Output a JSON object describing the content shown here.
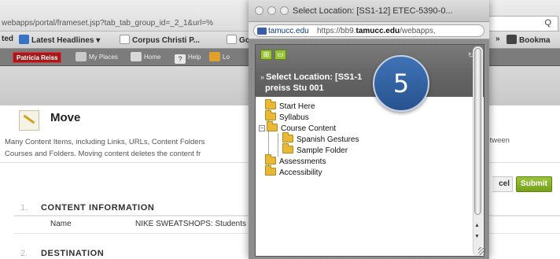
{
  "browser": {
    "url_text": "webapps/portal/frameset.jsp?tab_tab_group_id=_2_1&url=%",
    "search_glyph": "Q",
    "bookmarks": [
      {
        "label": "ted",
        "icon": "none"
      },
      {
        "label": "Latest Headlines",
        "icon": "rss-folder-icon"
      },
      {
        "label": "Corpus Christi P...",
        "icon": "page-icon"
      },
      {
        "label": "Go",
        "icon": "page-icon"
      }
    ],
    "bookmarks_overflow": "»",
    "bookmarks_menu": "Bookma"
  },
  "blackboard_bar": {
    "user": "Patricia Reiss",
    "my_places": "My Places",
    "home": "Home",
    "help": "Help",
    "logout": "Lo"
  },
  "page": {
    "title": "Move",
    "instructions_line1": "Many Content Items, including Links, URLs, Content Folders",
    "instructions_line2": "Courses and Folders. Moving content deletes the content fr",
    "instructions_right": "between",
    "cancel_label": "cel",
    "submit_label": "Submit",
    "section1_num": "1.",
    "section1_title": "CONTENT INFORMATION",
    "name_label": "Name",
    "name_value": "NIKE SWEATSHOPS: Students",
    "section2_num": "2.",
    "section2_title": "DESTINATION"
  },
  "popup": {
    "window_title": "Select Location: [SS1-12] ETEC-5390-0...",
    "address_domain": "tamucc.edu",
    "address_url_prefix": "https://bb9.",
    "address_url_bold": "tamucc.edu",
    "address_url_suffix": "/webapps,",
    "toolbar_refresh": "↻",
    "header_line1": "Select Location: [SS1-1",
    "header_line1_tail": "001",
    "header_line2": "preiss Stu 001",
    "tree": [
      {
        "label": "Start Here"
      },
      {
        "label": "Syllabus"
      },
      {
        "label": "Course Content"
      },
      {
        "label": "Spanish Gestures"
      },
      {
        "label": "Sample Folder"
      },
      {
        "label": "Assessments"
      },
      {
        "label": "Accessibility"
      }
    ]
  },
  "step_badge": "5",
  "colors": {
    "submit_green": "#8ab52a",
    "badge_blue": "#2f5fa0",
    "folder_yellow": "#e9b935",
    "bb_user_red": "#a31c1c"
  }
}
